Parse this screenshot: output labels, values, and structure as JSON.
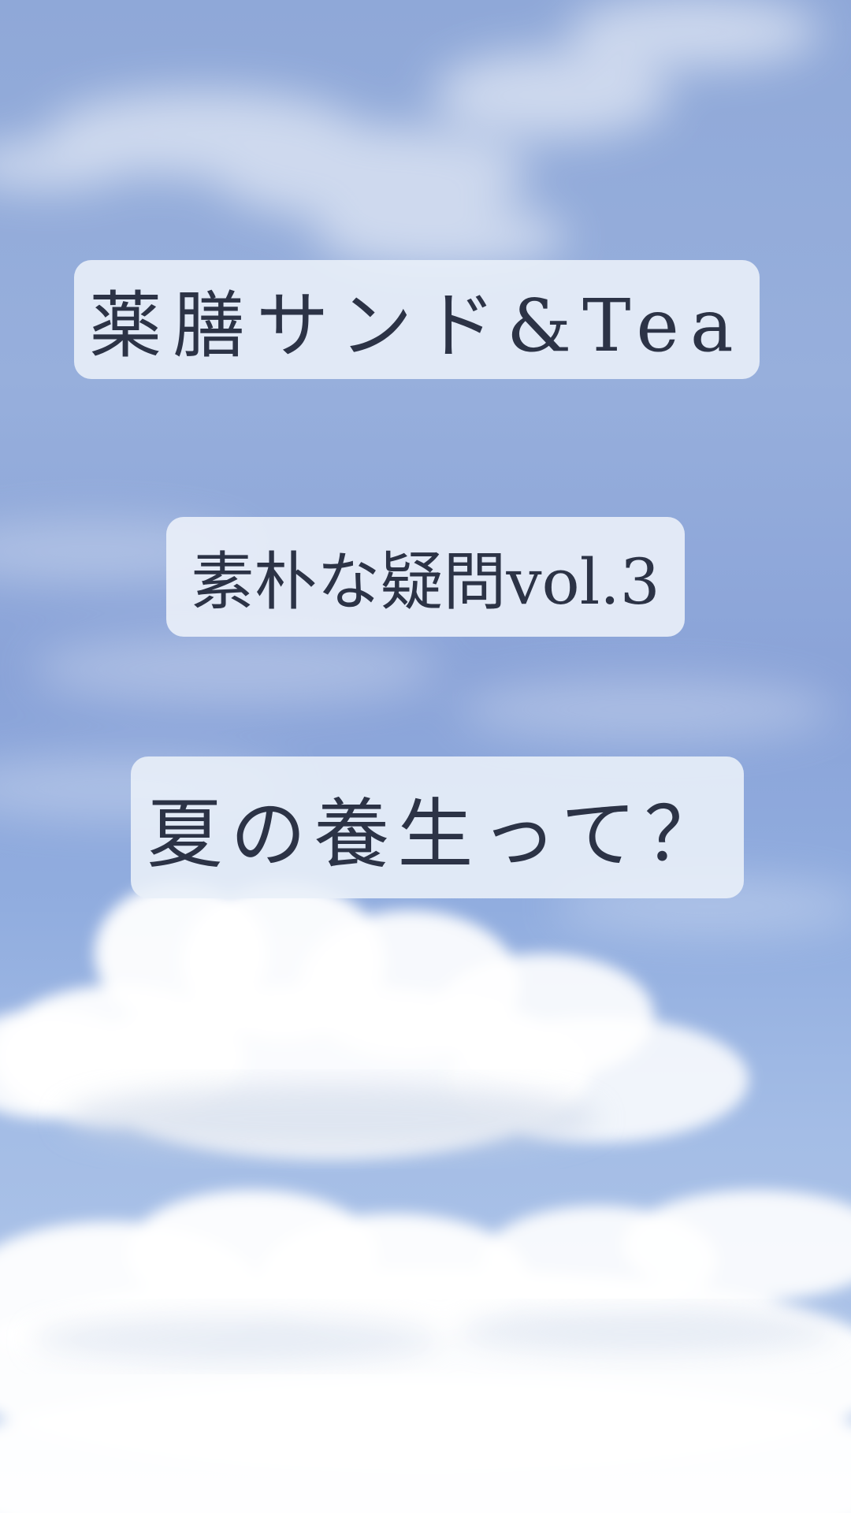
{
  "background": {
    "description_icon": "sky-clouds",
    "sky_color": "#8fa8d8",
    "cloud_color": "#ffffff"
  },
  "title": "薬膳サンド&Tea",
  "subtitle": "素朴な疑問vol.3",
  "question": "夏の養生って？",
  "colors": {
    "box_background": "#e9eff8",
    "text": "#2c3346"
  }
}
